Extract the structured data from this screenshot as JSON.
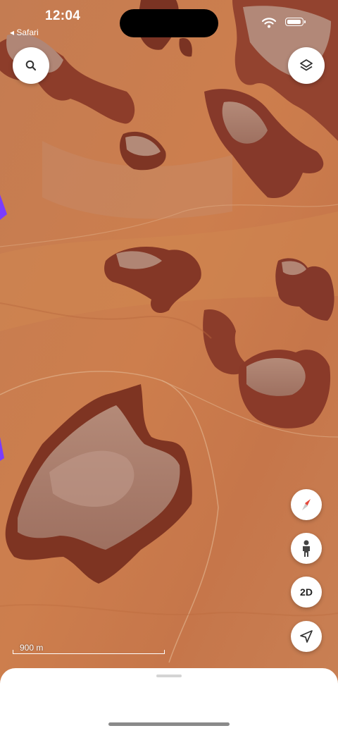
{
  "status_bar": {
    "time": "12:04",
    "back_label": "◂ Safari",
    "battery_level": 0.9
  },
  "map": {
    "type": "satellite-3d",
    "scale_label": "900 m"
  },
  "controls": {
    "search_icon": "magnifier-icon",
    "layers_icon": "layers-icon",
    "compass_icon": "compass-icon",
    "street_view_icon": "pegman-icon",
    "view_mode_label": "2D",
    "locate_icon": "location-arrow-icon"
  },
  "colors": {
    "terrain": "#c97a4a",
    "rock": "#8a3f2a",
    "compass_red": "#e5483b",
    "edge_accent": "#7a3cff"
  }
}
